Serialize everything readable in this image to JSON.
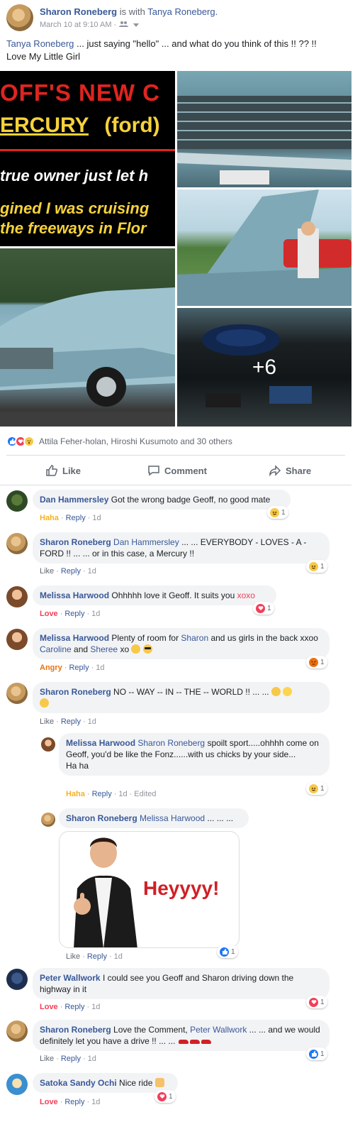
{
  "post": {
    "author": "Sharon Roneberg",
    "with_text": "is with",
    "tagged": "Tanya Roneberg.",
    "timestamp": "March 10 at 9:10 AM ·",
    "mention": "Tanya Roneberg",
    "text_1": " ... just saying \"hello\" ... and what do you think of this !! ?? !!",
    "text_2": "Love My Little Girl"
  },
  "photos": {
    "poster_line1": "OFF'S NEW C",
    "poster_line2a": "ERCURY",
    "poster_line2b": "(ford)",
    "poster_line3": "true owner just let h",
    "poster_line4": "gined I was cruising",
    "poster_line5": "the freeways in Flor",
    "more_count": "+6"
  },
  "reactions": {
    "summary": "Attila Feher-holan, Hiroshi Kusumoto and 30 others"
  },
  "actions": {
    "like": "Like",
    "comment": "Comment",
    "share": "Share"
  },
  "comments": [
    {
      "author": "Dan Hammersley",
      "text": "Got the wrong badge Geoff, no good mate",
      "reaction": "Haha",
      "reply": "Reply",
      "time": "1d",
      "count": "1"
    },
    {
      "author": "Sharon Roneberg",
      "mention": "Dan Hammersley",
      "text": " ... ... EVERYBODY - LOVES - A - FORD !! ... ... or in this case, a Mercury !!",
      "reaction": "Like",
      "reply": "Reply",
      "time": "1d",
      "count": "1"
    },
    {
      "author": "Melissa Harwood",
      "text": "Ohhhhh love it Geoff. It suits you ",
      "xoxo": "xoxo",
      "reaction": "Love",
      "reply": "Reply",
      "time": "1d",
      "count": "1"
    },
    {
      "author": "Melissa Harwood",
      "text_a": "Plenty of room for ",
      "mention_a": "Sharon",
      "text_b": " and us girls in the back xxoo ",
      "mention_b": "Caroline",
      "text_c": " and ",
      "mention_c": "Sheree",
      "text_d": " xo",
      "reaction": "Angry",
      "reply": "Reply",
      "time": "1d",
      "count": "1"
    },
    {
      "author": "Sharon Roneberg",
      "text": "NO -- WAY -- IN -- THE -- WORLD !! ... ...",
      "reaction": "Like",
      "reply": "Reply",
      "time": "1d"
    },
    {
      "author": "Melissa Harwood",
      "mention": "Sharon Roneberg",
      "text": " spoilt sport.....ohhhh come on Geoff, you'd be like the Fonz......with us chicks by your side...",
      "text_2": "Ha ha",
      "reaction": "Haha",
      "reply": "Reply",
      "time": "1d",
      "edited": "Edited",
      "count": "1"
    },
    {
      "author": "Sharon Roneberg",
      "mention": "Melissa Harwood",
      "text": " ... ... ...",
      "gif_caption": "Heyyyy!",
      "reaction": "Like",
      "reply": "Reply",
      "time": "1d",
      "count": "1"
    },
    {
      "author": "Peter Wallwork",
      "text": "I could see you Geoff and Sharon driving down the highway in it",
      "reaction": "Love",
      "reply": "Reply",
      "time": "1d",
      "count": "1"
    },
    {
      "author": "Sharon Roneberg",
      "text_a": "Love the Comment, ",
      "mention": "Peter Wallwork",
      "text_b": " ... ... and we would definitely let you have a drive !! ... ...",
      "reaction": "Like",
      "reply": "Reply",
      "time": "1d",
      "count": "1"
    },
    {
      "author": "Satoka Sandy Ochi",
      "text": "Nice ride",
      "reaction": "Love",
      "reply": "Reply",
      "time": "1d",
      "count": "1"
    }
  ],
  "colors": {
    "link": "#385898",
    "like_blue": "#2078f4",
    "love_red": "#f33e58",
    "haha_yellow": "#f7b125",
    "angry_orange": "#e9710f"
  }
}
